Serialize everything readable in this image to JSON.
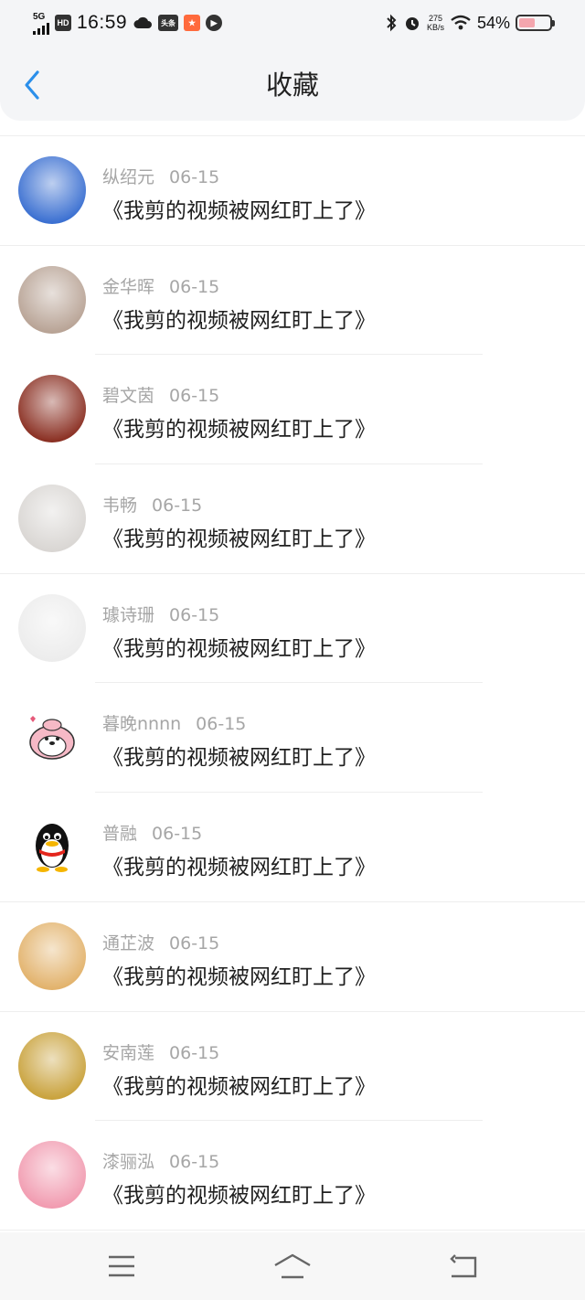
{
  "status_bar": {
    "network": "5G",
    "hd_label": "HD",
    "time": "16:59",
    "app_badge": "头条",
    "net_speed_value": "275",
    "net_speed_unit": "KB/s",
    "battery_percent": "54%",
    "battery_level": 0.54
  },
  "header": {
    "title": "收藏"
  },
  "items": [
    {
      "name": "纵绍元",
      "date": "06-15",
      "title": "《我剪的视频被网红盯上了》",
      "avatar": "avatar-girl-blue-hat",
      "color": "#3a6fd1"
    },
    {
      "name": "金华晖",
      "date": "06-15",
      "title": "《我剪的视频被网红盯上了》",
      "avatar": "avatar-anime-couple",
      "color": "#b8a395"
    },
    {
      "name": "碧文茵",
      "date": "06-15",
      "title": "《我剪的视频被网红盯上了》",
      "avatar": "avatar-red-costume",
      "color": "#8a2f22"
    },
    {
      "name": "韦畅",
      "date": "06-15",
      "title": "《我剪的视频被网红盯上了》",
      "avatar": "avatar-girl-portrait",
      "color": "#d9d6d3"
    },
    {
      "name": "璩诗珊",
      "date": "06-15",
      "title": "《我剪的视频被网红盯上了》",
      "avatar": "avatar-boy-white",
      "color": "#ececec"
    },
    {
      "name": "暮晚nnnn",
      "date": "06-15",
      "title": "《我剪的视频被网红盯上了》",
      "avatar": "avatar-pink-cartoon",
      "color": "#f3a8b8"
    },
    {
      "name": "普融",
      "date": "06-15",
      "title": "《我剪的视频被网红盯上了》",
      "avatar": "avatar-qq-penguin",
      "color": "#111111"
    },
    {
      "name": "通芷波",
      "date": "06-15",
      "title": "《我剪的视频被网红盯上了》",
      "avatar": "avatar-child-blonde",
      "color": "#e2b26b"
    },
    {
      "name": "安南莲",
      "date": "06-15",
      "title": "《我剪的视频被网红盯上了》",
      "avatar": "avatar-earrings",
      "color": "#c9a23c"
    },
    {
      "name": "漆骊泓",
      "date": "06-15",
      "title": "《我剪的视频被网红盯上了》",
      "avatar": "avatar-anime-pink-hair",
      "color": "#f19bb0"
    }
  ],
  "nav": {
    "menu_icon": "menu-icon",
    "home_icon": "home-icon",
    "back_icon": "back-nav-icon"
  },
  "colors": {
    "accent": "#2b8fea",
    "meta_text": "#a6a6a6",
    "title_text": "#1f1f1f"
  }
}
